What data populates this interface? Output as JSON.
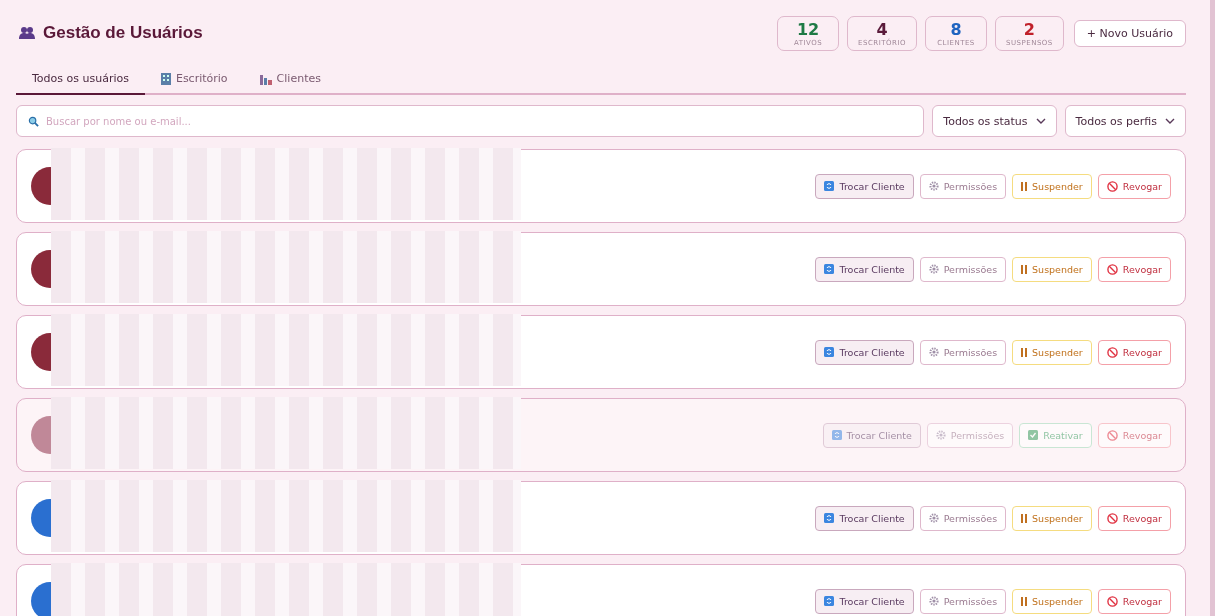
{
  "header": {
    "title": "Gestão de Usuários",
    "stats": [
      {
        "value": "12",
        "label": "ATIVOS",
        "color": "#1e7a45"
      },
      {
        "value": "4",
        "label": "ESCRITÓRIO",
        "color": "#5a1a3a"
      },
      {
        "value": "8",
        "label": "CLIENTES",
        "color": "#1f64c0"
      },
      {
        "value": "2",
        "label": "SUSPENSOS",
        "color": "#c0202a"
      }
    ],
    "new_button": "+ Novo Usuário"
  },
  "tabs": [
    {
      "label": "Todos os usuários",
      "selected": true,
      "kind": "all"
    },
    {
      "label": "Escritório",
      "selected": false,
      "kind": "office"
    },
    {
      "label": "Clientes",
      "selected": false,
      "kind": "clients"
    }
  ],
  "search": {
    "placeholder": "Buscar por nome ou e-mail..."
  },
  "filters": [
    "Todos os status",
    "Todos os perfis"
  ],
  "users": [
    {
      "suspended": false,
      "color": "#8a2a3a",
      "actions": [
        {
          "kind": "switch",
          "label": "Trocar Cliente"
        },
        {
          "kind": "perms",
          "label": "Permissões"
        },
        {
          "kind": "suspend",
          "label": "Suspender"
        },
        {
          "kind": "revoke",
          "label": "Revogar"
        }
      ]
    },
    {
      "suspended": false,
      "color": "#8a2a3a",
      "actions": [
        {
          "kind": "switch",
          "label": "Trocar Cliente"
        },
        {
          "kind": "perms",
          "label": "Permissões"
        },
        {
          "kind": "suspend",
          "label": "Suspender"
        },
        {
          "kind": "revoke",
          "label": "Revogar"
        }
      ]
    },
    {
      "suspended": false,
      "color": "#8a2a3a",
      "actions": [
        {
          "kind": "switch",
          "label": "Trocar Cliente"
        },
        {
          "kind": "perms",
          "label": "Permissões"
        },
        {
          "kind": "suspend",
          "label": "Suspender"
        },
        {
          "kind": "revoke",
          "label": "Revogar"
        }
      ]
    },
    {
      "suspended": true,
      "color": "#c08898",
      "actions": [
        {
          "kind": "switch",
          "label": "Trocar Cliente"
        },
        {
          "kind": "perms",
          "label": "Permissões"
        },
        {
          "kind": "reactivate",
          "label": "Reativar"
        },
        {
          "kind": "revoke",
          "label": "Revogar"
        }
      ]
    },
    {
      "suspended": false,
      "color": "#2a6fd0",
      "actions": [
        {
          "kind": "switch",
          "label": "Trocar Cliente"
        },
        {
          "kind": "perms",
          "label": "Permissões"
        },
        {
          "kind": "suspend",
          "label": "Suspender"
        },
        {
          "kind": "revoke",
          "label": "Revogar"
        }
      ]
    },
    {
      "suspended": false,
      "color": "#2a6fd0",
      "actions": [
        {
          "kind": "switch",
          "label": "Trocar Cliente"
        },
        {
          "kind": "perms",
          "label": "Permissões"
        },
        {
          "kind": "suspend",
          "label": "Suspender"
        },
        {
          "kind": "revoke",
          "label": "Revogar"
        }
      ]
    }
  ]
}
